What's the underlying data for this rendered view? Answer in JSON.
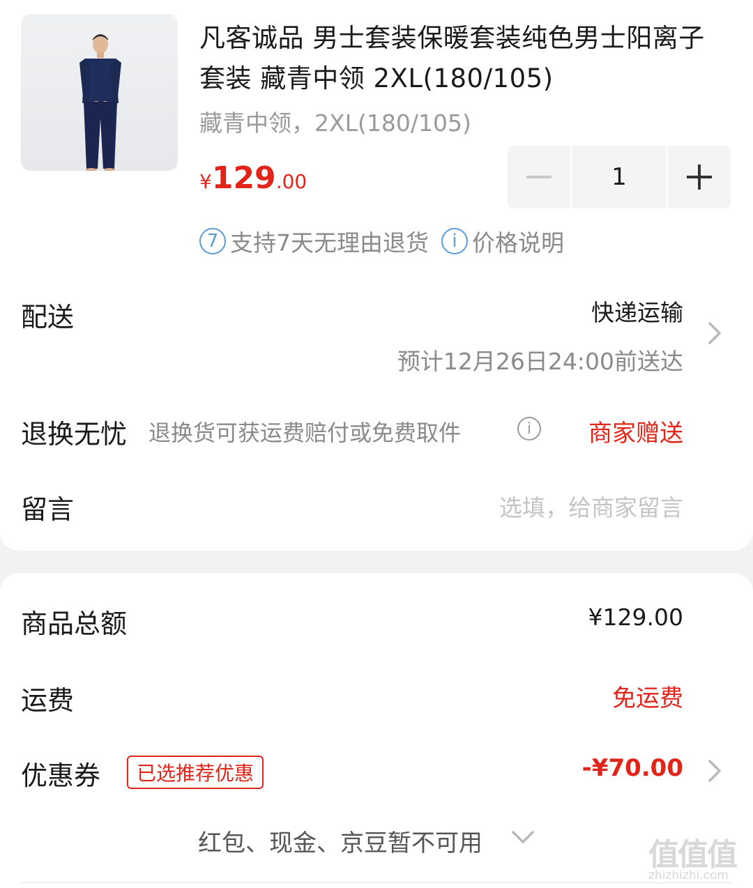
{
  "product": {
    "title": "凡客诚品 男士套装保暖套装纯色男士阳离子套装 藏青中领 2XL(180/105)",
    "spec": "藏青中领，2XL(180/105)",
    "price_currency": "¥",
    "price_integer": "129",
    "price_decimal": ".00",
    "quantity": "1",
    "minus_icon": "minus-icon",
    "plus_icon": "plus-icon",
    "badge_return_icon_text": "7",
    "badge_return": "支持7天无理由退货",
    "badge_price_icon_text": "i",
    "badge_price": "价格说明"
  },
  "delivery": {
    "label": "配送",
    "method": "快递运输",
    "eta": "预计12月26日24:00前送达"
  },
  "return": {
    "label": "退换无忧",
    "desc": "退换货可获运费赔付或免费取件",
    "icon_text": "i",
    "value": "商家赠送"
  },
  "message": {
    "label": "留言",
    "placeholder": "选填，给商家留言"
  },
  "summary": {
    "goods_total_label": "商品总额",
    "goods_total_value": "¥129.00",
    "shipping_label": "运费",
    "shipping_value": "免运费",
    "coupon_label": "优惠券",
    "coupon_tag": "已选推荐优惠",
    "coupon_value": "-¥70.00",
    "unavailable": "红包、现金、京豆暂不可用"
  },
  "watermark": {
    "logo": "值值值",
    "url": "zhizhizhi.com"
  },
  "colors": {
    "accent_red": "#e1251b",
    "info_blue": "#5b9bd9",
    "muted_gray": "#9a9a9a"
  }
}
